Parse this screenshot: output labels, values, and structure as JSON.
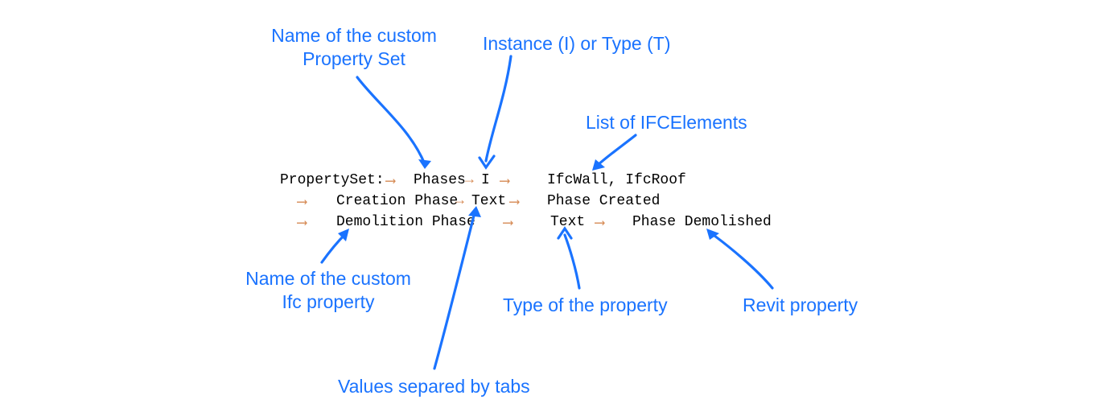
{
  "annotations": {
    "pset_name": "Name of the custom\nProperty Set",
    "instance_or_type": "Instance (I) or Type (T)",
    "ifc_elements": "List of IFCElements",
    "ifc_property": "Name of the custom\nIfc property",
    "tabs": "Values separed by tabs",
    "prop_type": "Type of the property",
    "revit_prop": "Revit property"
  },
  "code": {
    "label_propertyset": "PropertySet:",
    "pset_name": "Phases",
    "instance_flag": "I",
    "ifc_elements": "IfcWall, IfcRoof",
    "row2_name": "Creation Phase",
    "row2_type": "Text",
    "row2_value": "Phase Created",
    "row3_name": "Demolition Phase",
    "row3_type": "Text",
    "row3_value": "Phase Demolished"
  }
}
